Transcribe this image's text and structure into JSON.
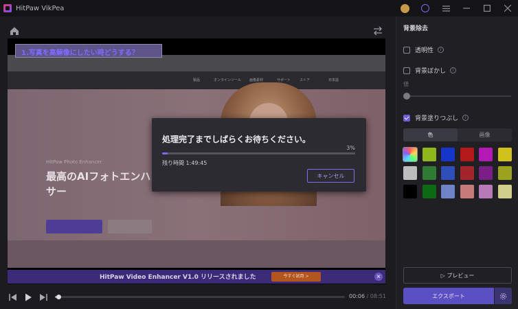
{
  "app": {
    "title": "HitPaw VikPea"
  },
  "video": {
    "annotation": "1.写真を高解像にしたい時どうする？",
    "web": {
      "nav": [
        "製品",
        "オンラインツール",
        "画像素材",
        "サポート",
        "ストア",
        "日本語"
      ],
      "hero_sub": "HitPaw Photo Enhancer",
      "hero_title_line1": "最高のAIフォトエンハン",
      "hero_title_line2": "サー"
    },
    "banner": {
      "text": "HitPaw Video Enhancer V1.0 リリースされました",
      "button": "今すぐ試用 >",
      "close": "×"
    }
  },
  "playback": {
    "current": "00:06",
    "separator": "/",
    "duration": "08:51",
    "progress": 0.012
  },
  "modal": {
    "title": "処理完了までしばらくお待ちください。",
    "percent_label": "3%",
    "progress": 0.03,
    "remaining_label": "残り時間",
    "remaining_value": "1:49:45",
    "cancel": "キャンセル"
  },
  "panel": {
    "title": "背景除去",
    "transparent": "透明性",
    "blur": "背景ぼかし",
    "blur_slider_label": "値",
    "fill": "背景塗りつぶし",
    "tab_color": "色",
    "tab_image": "画像",
    "swatches": [
      "gradient",
      "#8fb81a",
      "#1536c9",
      "#b21a1a",
      "#b31ab3",
      "#d0c21a",
      "#bdbdbd",
      "#2f7a34",
      "#2f4fb8",
      "#a3252b",
      "#7a1f86",
      "#9aa21e",
      "#000000",
      "#0c6a14",
      "#6f83c8",
      "#c57a7a",
      "#b77ab7",
      "#cfcf8a"
    ],
    "preview": "プレビュー",
    "export": "エクスポート"
  }
}
